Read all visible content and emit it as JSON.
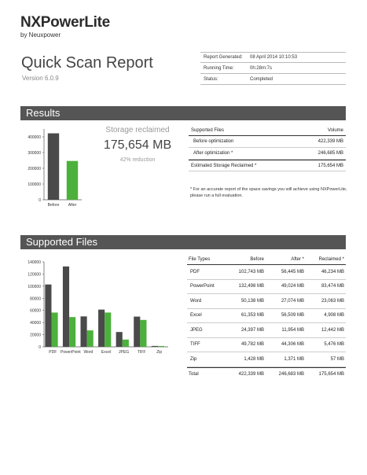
{
  "logo": {
    "name": "NXPowerLite",
    "by": "by Neuxpower"
  },
  "report": {
    "title": "Quick Scan Report",
    "version": "Version 6.0.9"
  },
  "meta": [
    {
      "label": "Report Generated:",
      "value": "08 April 2014 10:10:53"
    },
    {
      "label": "Running Time:",
      "value": "0h:28m:7s"
    },
    {
      "label": "Status:",
      "value": "Completed"
    }
  ],
  "results": {
    "heading": "Results",
    "storage_label": "Storage reclaimed",
    "storage_value": "175,654 MB",
    "reduction": "42% reduction",
    "table": {
      "col1": "Supported Files",
      "col2": "Volume",
      "rows": [
        {
          "label": "Before optimization",
          "value": "422,339 MB"
        },
        {
          "label": "After optimization *",
          "value": "246,685 MB"
        }
      ],
      "total": {
        "label": "Estimated Storage Reclaimed *",
        "value": "175,654 MB"
      }
    },
    "footnote": "* For an accurate report of the space savings you will achieve using NXPowerLite, please run a full evaluation."
  },
  "supported_files": {
    "heading": "Supported Files",
    "headers": [
      "File Types",
      "Before",
      "After *",
      "Reclaimed *"
    ],
    "rows": [
      [
        "PDF",
        "102,743 MB",
        "56,445 MB",
        "46,234 MB"
      ],
      [
        "PowerPoint",
        "132,498 MB",
        "49,024 MB",
        "83,474 MB"
      ],
      [
        "Word",
        "50,138 MB",
        "27,074 MB",
        "23,063 MB"
      ],
      [
        "Excel",
        "61,353 MB",
        "56,509 MB",
        "4,908 MB"
      ],
      [
        "JPEG",
        "24,397 MB",
        "11,954 MB",
        "12,442 MB"
      ],
      [
        "TIFF",
        "49,782 MB",
        "44,306 MB",
        "5,476 MB"
      ],
      [
        "Zip",
        "1,428 MB",
        "1,371 MB",
        "57 MB"
      ]
    ],
    "total": [
      "Total",
      "422,339 MB",
      "246,683 MB",
      "175,654 MB"
    ]
  },
  "colors": {
    "before": "#4a4a4a",
    "after": "#4cb03c",
    "bar": "#555555"
  },
  "chart_data": [
    {
      "type": "bar",
      "categories": [
        "Before",
        "After"
      ],
      "series": [
        {
          "values": [
            422339,
            246685
          ]
        }
      ],
      "yticks": [
        "0",
        "100000",
        "200000",
        "300000",
        "400000"
      ],
      "ylim": [
        0,
        450000
      ]
    },
    {
      "type": "bar",
      "categories": [
        "PDF",
        "PowerPoint",
        "Word",
        "Excel",
        "JPEG",
        "TIFF",
        "Zip"
      ],
      "series": [
        {
          "values": [
            102743,
            132498,
            50138,
            61353,
            24397,
            49782,
            1428
          ]
        },
        {
          "values": [
            56445,
            49024,
            27074,
            56509,
            11954,
            44306,
            1371
          ]
        }
      ],
      "yticks": [
        "0",
        "20000",
        "40000",
        "60000",
        "80000",
        "100000",
        "120000",
        "140000"
      ],
      "ylim": [
        0,
        140000
      ]
    }
  ]
}
